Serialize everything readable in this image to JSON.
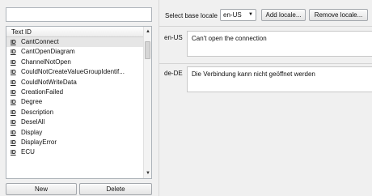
{
  "search": {
    "placeholder": "",
    "value": ""
  },
  "list": {
    "header": "Text ID",
    "icon_label": "ID",
    "items": [
      "CantConnect",
      "CantOpenDiagram",
      "ChannelNotOpen",
      "CouldNotCreateValueGroupIdentif...",
      "CouldNotWriteData",
      "CreationFailed",
      "Degree",
      "Description",
      "DeselAll",
      "Display",
      "DisplayError",
      "ECU"
    ],
    "selected_index": 0
  },
  "buttons": {
    "new": "New",
    "delete": "Delete"
  },
  "toolbar": {
    "base_locale_label": "Select base locale",
    "base_locale_value": "en-US",
    "add_locale": "Add locale...",
    "remove_locale": "Remove locale..."
  },
  "locales": [
    {
      "code": "en-US",
      "text": "Can't open the connection"
    },
    {
      "code": "de-DE",
      "text": "Die Verbindung kann nicht geöffnet werden"
    }
  ]
}
